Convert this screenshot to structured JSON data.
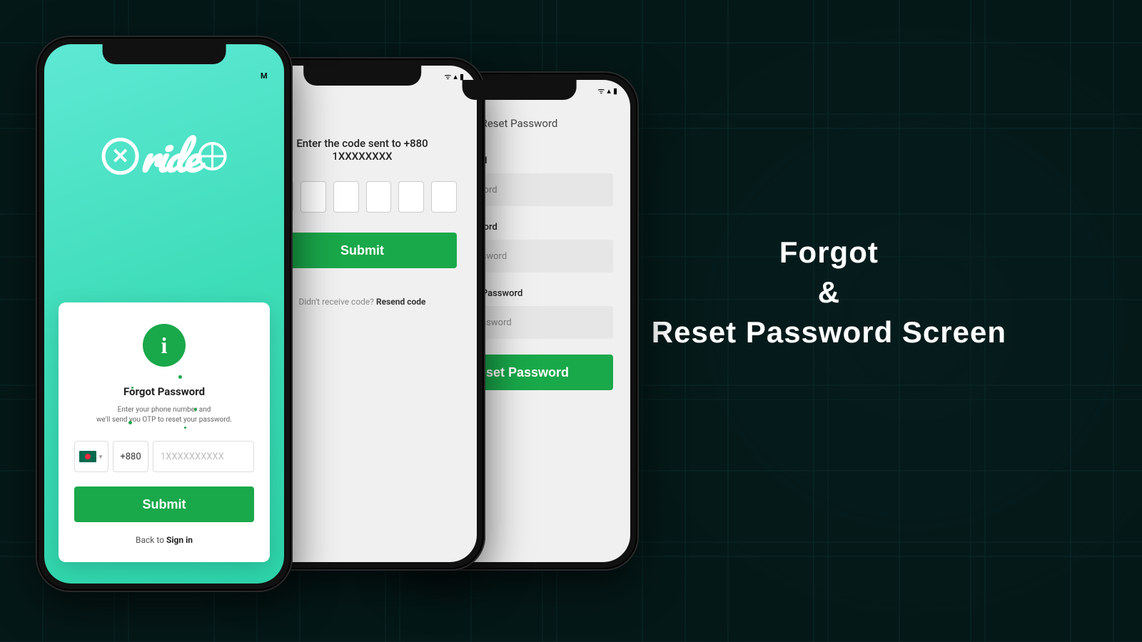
{
  "title": {
    "line1": "Forgot",
    "amp": "&",
    "line2": "Reset Password Screen"
  },
  "brand": "ride",
  "phone1": {
    "info_icon_letter": "i",
    "heading": "Forgot Password",
    "desc_line1": "Enter your phone number and",
    "desc_line2": "we'll send you OTP to reset your password.",
    "dial_code": "+880",
    "phone_placeholder": "1XXXXXXXXXX",
    "submit": "Submit",
    "back_text": "Back to ",
    "signin": "Sign in"
  },
  "phone2": {
    "prompt": "Enter the code sent to +880 1XXXXXXXX",
    "submit": "Submit",
    "resend_text": "Didn't receive code? ",
    "resend_link": "Resend code"
  },
  "phone3": {
    "title": "Reset Password",
    "f1_label": "New Password",
    "f1_placeholder": "New Password",
    "f2_label": "Retype Password",
    "f2_placeholder": "Retype Password",
    "f3_label": "Confirm New Password",
    "f3_placeholder": "Confirm Password",
    "submit": "Reset Password"
  }
}
